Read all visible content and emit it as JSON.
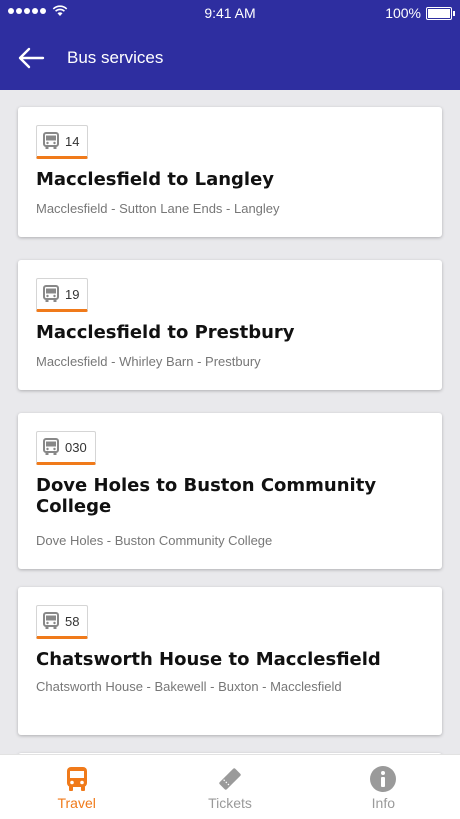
{
  "status_bar": {
    "time": "9:41 AM",
    "battery": "100%"
  },
  "header": {
    "title": "Bus services"
  },
  "routes": [
    {
      "number": "14",
      "title": "Macclesfield to Langley",
      "stops": "Macclesfield - Sutton Lane Ends - Langley"
    },
    {
      "number": "19",
      "title": "Macclesfield to Prestbury",
      "stops": "Macclesfield - Whirley Barn - Prestbury"
    },
    {
      "number": "030",
      "title": "Dove Holes to Buston Community College",
      "stops": "Dove Holes - Buston Community College"
    },
    {
      "number": "58",
      "title": "Chatsworth House to Macclesfield",
      "stops": "Chatsworth House - Bakewell - Buxton - Macclesfield"
    }
  ],
  "nav": {
    "items": [
      {
        "label": "Travel",
        "icon": "bus-icon",
        "active": true
      },
      {
        "label": "Tickets",
        "icon": "ticket-icon",
        "active": false
      },
      {
        "label": "Info",
        "icon": "info-icon",
        "active": false
      }
    ]
  },
  "colors": {
    "primary": "#2e2ea0",
    "accent": "#f07a1a",
    "inactive": "#9a9a9a"
  }
}
